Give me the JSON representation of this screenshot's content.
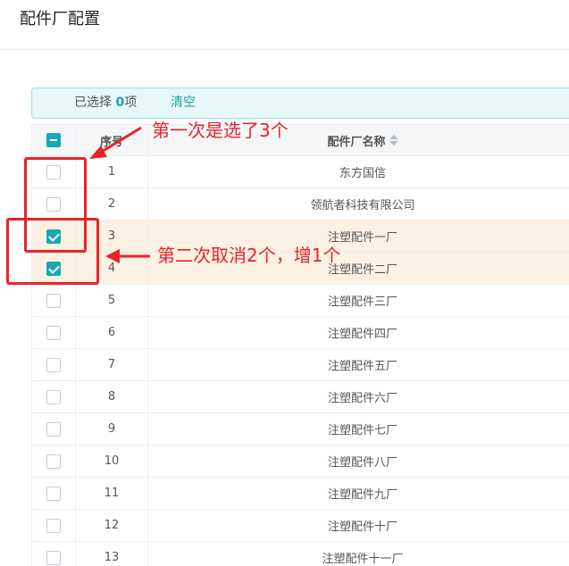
{
  "page": {
    "title": "配件厂配置"
  },
  "selection": {
    "prefix": "已选择 ",
    "count": "0",
    "suffix": "项",
    "clear_label": "清空"
  },
  "table": {
    "headers": {
      "index": "序号",
      "name": "配件厂名称"
    },
    "rows": [
      {
        "index": "1",
        "name": "东方国信",
        "checked": false
      },
      {
        "index": "2",
        "name": "领航者科技有限公司",
        "checked": false
      },
      {
        "index": "3",
        "name": "注塑配件一厂",
        "checked": true
      },
      {
        "index": "4",
        "name": "注塑配件二厂",
        "checked": true
      },
      {
        "index": "5",
        "name": "注塑配件三厂",
        "checked": false
      },
      {
        "index": "6",
        "name": "注塑配件四厂",
        "checked": false
      },
      {
        "index": "7",
        "name": "注塑配件五厂",
        "checked": false
      },
      {
        "index": "8",
        "name": "注塑配件六厂",
        "checked": false
      },
      {
        "index": "9",
        "name": "注塑配件七厂",
        "checked": false
      },
      {
        "index": "10",
        "name": "注塑配件八厂",
        "checked": false
      },
      {
        "index": "11",
        "name": "注塑配件九厂",
        "checked": false
      },
      {
        "index": "12",
        "name": "注塑配件十厂",
        "checked": false
      },
      {
        "index": "13",
        "name": "注塑配件十一厂",
        "checked": false
      }
    ]
  },
  "annotations": {
    "first": "第一次是选了3个",
    "second": "第二次取消2个，增1个"
  },
  "colors": {
    "accent": "#17a8b4",
    "annotation": "#e8232b",
    "selected_row": "#fdf1e3"
  }
}
